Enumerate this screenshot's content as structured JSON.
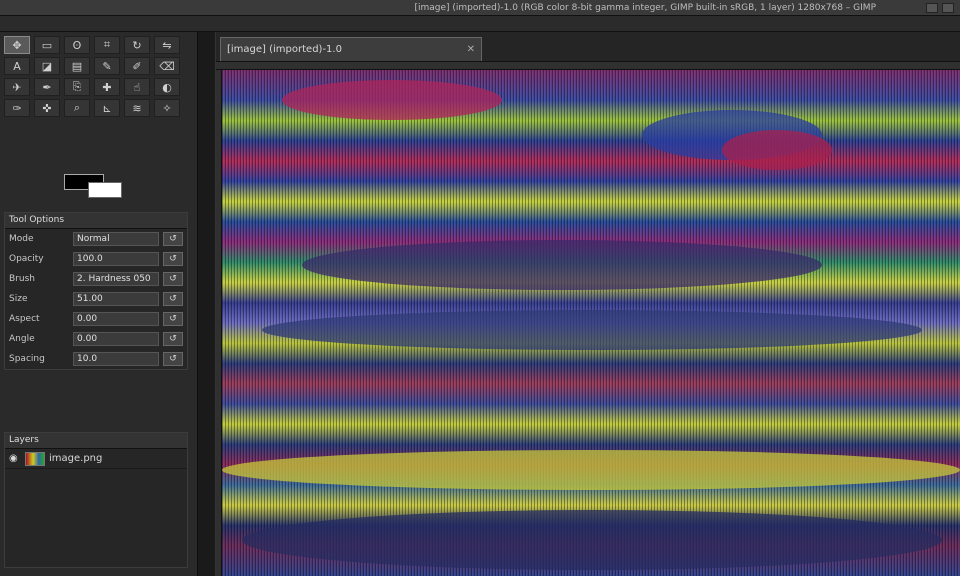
{
  "window": {
    "title": "[image] (imported)-1.0 (RGB color 8-bit gamma integer, GIMP built-in sRGB, 1 layer) 1280x768 – GIMP"
  },
  "toolbox": {
    "tools": [
      {
        "name": "move-tool-icon",
        "glyph": "✥"
      },
      {
        "name": "rect-select-icon",
        "glyph": "▭"
      },
      {
        "name": "lasso-icon",
        "glyph": "ʘ"
      },
      {
        "name": "crop-icon",
        "glyph": "⌗"
      },
      {
        "name": "rotate-icon",
        "glyph": "↻"
      },
      {
        "name": "flip-icon",
        "glyph": "⇋"
      },
      {
        "name": "text-icon",
        "glyph": "A"
      },
      {
        "name": "paint-bucket-icon",
        "glyph": "◪"
      },
      {
        "name": "gradient-icon",
        "glyph": "▤"
      },
      {
        "name": "pencil-icon",
        "glyph": "✎"
      },
      {
        "name": "brush-icon",
        "glyph": "✐"
      },
      {
        "name": "eraser-icon",
        "glyph": "⌫"
      },
      {
        "name": "airbrush-icon",
        "glyph": "✈"
      },
      {
        "name": "ink-icon",
        "glyph": "✒"
      },
      {
        "name": "clone-icon",
        "glyph": "⎘"
      },
      {
        "name": "heal-icon",
        "glyph": "✚"
      },
      {
        "name": "smudge-icon",
        "glyph": "☝"
      },
      {
        "name": "dodge-icon",
        "glyph": "◐"
      },
      {
        "name": "path-icon",
        "glyph": "✑"
      },
      {
        "name": "color-picker-icon",
        "glyph": "✜"
      },
      {
        "name": "zoom-icon",
        "glyph": "⌕"
      },
      {
        "name": "measure-icon",
        "glyph": "⊾"
      },
      {
        "name": "warp-icon",
        "glyph": "≋"
      },
      {
        "name": "fuzzy-select-icon",
        "glyph": "✧"
      }
    ],
    "fg_color": "#000000",
    "bg_color": "#ffffff"
  },
  "tool_options": {
    "title": "Tool Options",
    "rows": [
      {
        "label": "Mode",
        "value": "Normal"
      },
      {
        "label": "Opacity",
        "value": "100.0"
      },
      {
        "label": "Brush",
        "value": "2. Hardness 050"
      },
      {
        "label": "Size",
        "value": "51.00"
      },
      {
        "label": "Aspect",
        "value": "0.00"
      },
      {
        "label": "Angle",
        "value": "0.00"
      },
      {
        "label": "Spacing",
        "value": "10.0"
      }
    ]
  },
  "layers": {
    "title": "Layers",
    "items": [
      {
        "name": "image.png"
      }
    ]
  },
  "tab": {
    "label": "[image] (imported)-1.0"
  }
}
